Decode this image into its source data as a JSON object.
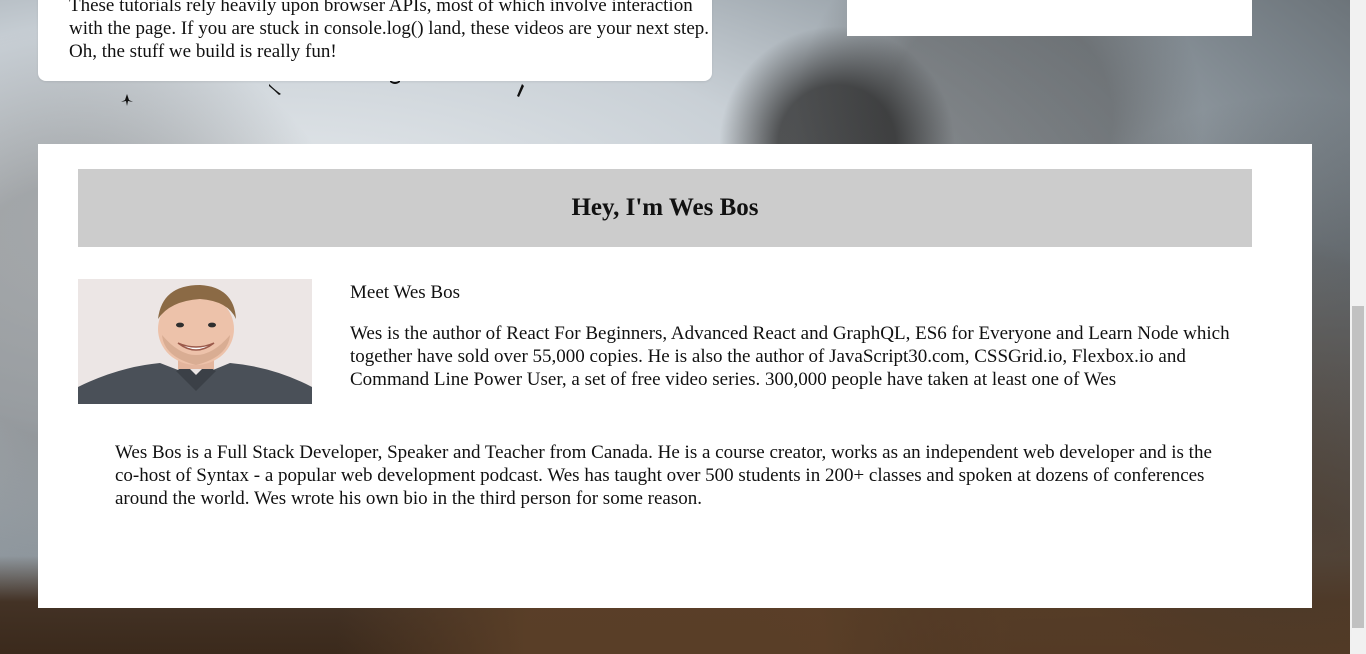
{
  "intro_card": {
    "text": "These tutorials rely heavily upon browser APIs, most of which involve interaction with the page. If you are stuck in console.log() land, these videos are your next step. Oh, the stuff we build is really fun!"
  },
  "about": {
    "heading": "Hey, I'm Wes Bos",
    "meet_title": "Meet Wes Bos",
    "meet_text": "Wes is the author of React For Beginners, Advanced React and GraphQL, ES6 for Everyone and Learn Node which together have sold over 55,000 copies. He is also the author of JavaScript30.com, CSSGrid.io, Flexbox.io and Command Line Power User, a set of free video series. 300,000 people have taken at least one of Wes",
    "bio": "Wes Bos is a Full Stack Developer, Speaker and Teacher from Canada. He is a course creator, works as an independent web developer and is the co-host of Syntax - a popular web development podcast. Wes has taught over 500 students in 200+ classes and spoken at dozens of conferences around the world. Wes wrote his own bio in the third person for some reason."
  },
  "icons": {
    "photo": "portrait-photo",
    "birds": "bird-icon"
  },
  "colors": {
    "header_bg": "#cccccc",
    "card_bg": "#ffffff",
    "scrollbar_thumb": "#c1c1c1"
  }
}
